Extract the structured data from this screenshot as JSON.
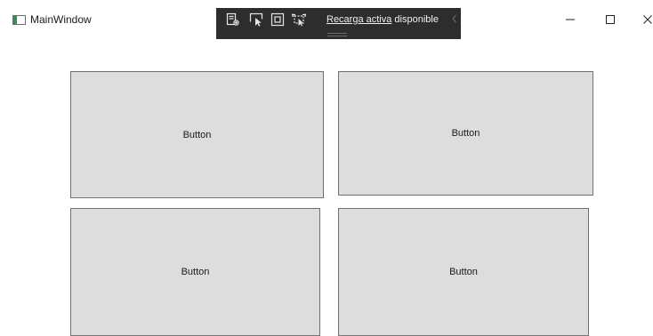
{
  "window": {
    "title": "MainWindow",
    "icon": "wpf-window-icon",
    "caption_buttons": [
      "minimize-icon",
      "maximize-icon",
      "close-icon"
    ]
  },
  "debug_toolbar": {
    "tools": [
      "live-visual-tree-icon",
      "select-element-icon",
      "display-adorners-icon",
      "track-focus-icon"
    ],
    "hot_reload_link": "Recarga activa",
    "hot_reload_status": " disponible",
    "collapse_icon": "chevron-left-icon"
  },
  "buttons": [
    {
      "label": "Button"
    },
    {
      "label": "Button"
    },
    {
      "label": "Button"
    },
    {
      "label": "Button"
    }
  ],
  "colors": {
    "button_background": "#dddddd",
    "button_border": "#707070",
    "toolbar_background": "#2d2d2d",
    "window_background": "#ffffff"
  }
}
